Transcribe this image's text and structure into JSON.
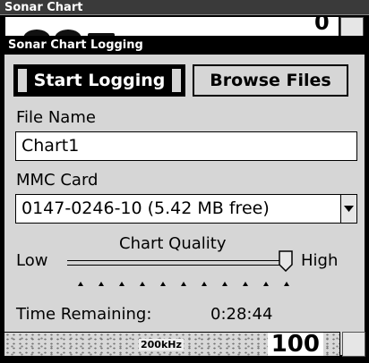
{
  "window": {
    "title": "Sonar Chart"
  },
  "background": {
    "depth_digit": "0"
  },
  "dialog": {
    "title": "Sonar Chart Logging",
    "start_button": "Start Logging",
    "browse_button": "Browse Files",
    "file_name_label": "File Name",
    "file_name_value": "Chart1",
    "mmc_label": "MMC Card",
    "mmc_value": "0147-0246-10 (5.42 MB free)",
    "quality_label": "Chart Quality",
    "quality_low": "Low",
    "quality_high": "High",
    "quality_level": 1.0,
    "quality_steps": 11,
    "time_label": "Time Remaining:",
    "time_value": "0:28:44"
  },
  "status_bar": {
    "frequency": "200kHz",
    "depth": "100"
  }
}
